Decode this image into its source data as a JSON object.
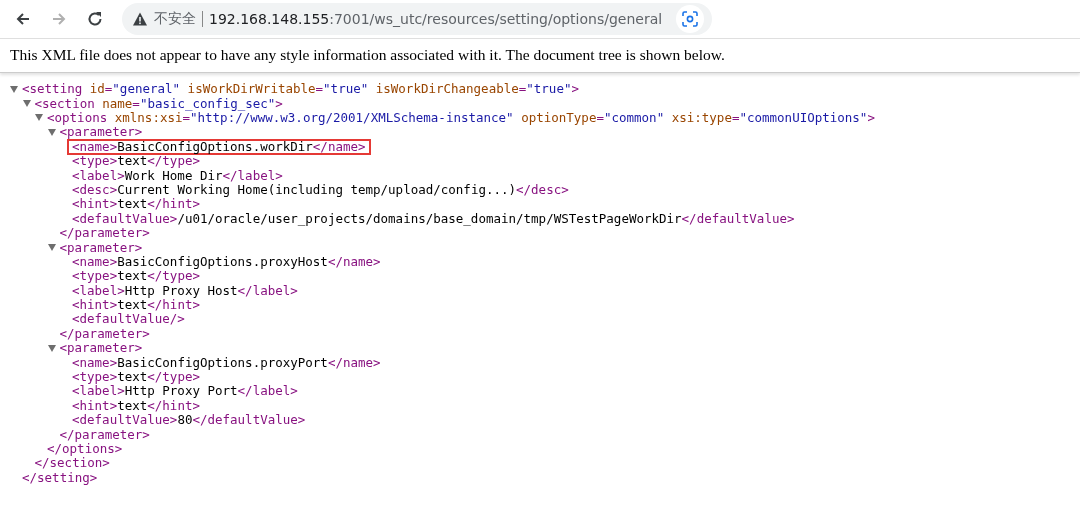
{
  "browser": {
    "nav_buttons": [
      {
        "kind": "back",
        "disabled": false
      },
      {
        "kind": "forward",
        "disabled": true
      },
      {
        "kind": "reload",
        "disabled": false
      }
    ],
    "address": {
      "security_label": "不安全",
      "host": "192.168.148.155",
      "path": ":7001/ws_utc/resources/setting/options/general"
    }
  },
  "notice": "This XML file does not appear to have any style information associated with it. The document tree is shown below.",
  "xml_tree": [
    {
      "open": "<setting id=\"general\" isWorkDirWritable=\"true\" isWorkDirChangeable=\"true\">",
      "expanded": true,
      "highlighted": false,
      "close": "</setting>",
      "children": [
        {
          "open": "<section name=\"basic_config_sec\">",
          "expanded": true,
          "highlighted": false,
          "close": "</section>",
          "children": [
            {
              "open": "<options xmlns:xsi=\"http://www.w3.org/2001/XMLSchema-instance\" optionType=\"common\" xsi:type=\"commonUIOptions\">",
              "expanded": true,
              "highlighted": false,
              "close": "</options>",
              "children": [
                {
                  "open": "<parameter>",
                  "expanded": true,
                  "highlighted": false,
                  "close": "</parameter>",
                  "children": [
                    {
                      "open": "<name>BasicConfigOptions.workDir</name>",
                      "highlighted": true
                    },
                    {
                      "open": "<type>text</type>",
                      "highlighted": false
                    },
                    {
                      "open": "<label>Work Home Dir</label>",
                      "highlighted": false
                    },
                    {
                      "open": "<desc>Current Working Home(including temp/upload/config...)</desc>",
                      "highlighted": false
                    },
                    {
                      "open": "<hint>text</hint>",
                      "highlighted": false
                    },
                    {
                      "open": "<defaultValue>/u01/oracle/user_projects/domains/base_domain/tmp/WSTestPageWorkDir</defaultValue>",
                      "highlighted": false
                    }
                  ]
                },
                {
                  "open": "<parameter>",
                  "expanded": true,
                  "highlighted": false,
                  "close": "</parameter>",
                  "children": [
                    {
                      "open": "<name>BasicConfigOptions.proxyHost</name>",
                      "highlighted": false
                    },
                    {
                      "open": "<type>text</type>",
                      "highlighted": false
                    },
                    {
                      "open": "<label>Http Proxy Host</label>",
                      "highlighted": false
                    },
                    {
                      "open": "<hint>text</hint>",
                      "highlighted": false
                    },
                    {
                      "open": "<defaultValue/>",
                      "highlighted": false
                    }
                  ]
                },
                {
                  "open": "<parameter>",
                  "expanded": true,
                  "highlighted": false,
                  "close": "</parameter>",
                  "children": [
                    {
                      "open": "<name>BasicConfigOptions.proxyPort</name>",
                      "highlighted": false
                    },
                    {
                      "open": "<type>text</type>",
                      "highlighted": false
                    },
                    {
                      "open": "<label>Http Proxy Port</label>",
                      "highlighted": false
                    },
                    {
                      "open": "<hint>text</hint>",
                      "highlighted": false
                    },
                    {
                      "open": "<defaultValue>80</defaultValue>",
                      "highlighted": false
                    }
                  ]
                }
              ]
            }
          ]
        }
      ]
    }
  ]
}
